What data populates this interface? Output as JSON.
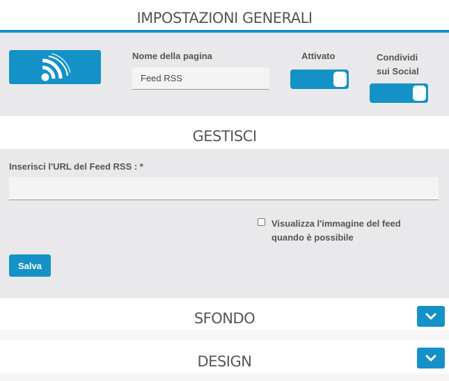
{
  "general": {
    "title": "IMPOSTAZIONI GENERALI",
    "page_name_label": "Nome della pagina",
    "page_name_value": "Feed RSS",
    "active_label": "Attivato",
    "share_label_line1": "Condividi",
    "share_label_line2": "sui Social",
    "active_on": true,
    "share_on": true
  },
  "manage": {
    "title": "GESTISCI",
    "url_label": "Inserisci l'URL del Feed RSS : *",
    "url_value": "",
    "show_image_label_line1": "Visualizza l'immagine del feed",
    "show_image_label_line2": "quando è possibile",
    "show_image_checked": false,
    "save_label": "Salva"
  },
  "background": {
    "title": "SFONDO"
  },
  "design": {
    "title": "DESIGN"
  },
  "icons": {
    "rss": "rss-icon",
    "chevron": "chevron-down-icon"
  },
  "colors": {
    "accent": "#1492c8",
    "panel": "#e9e9eb",
    "text": "#555555"
  }
}
